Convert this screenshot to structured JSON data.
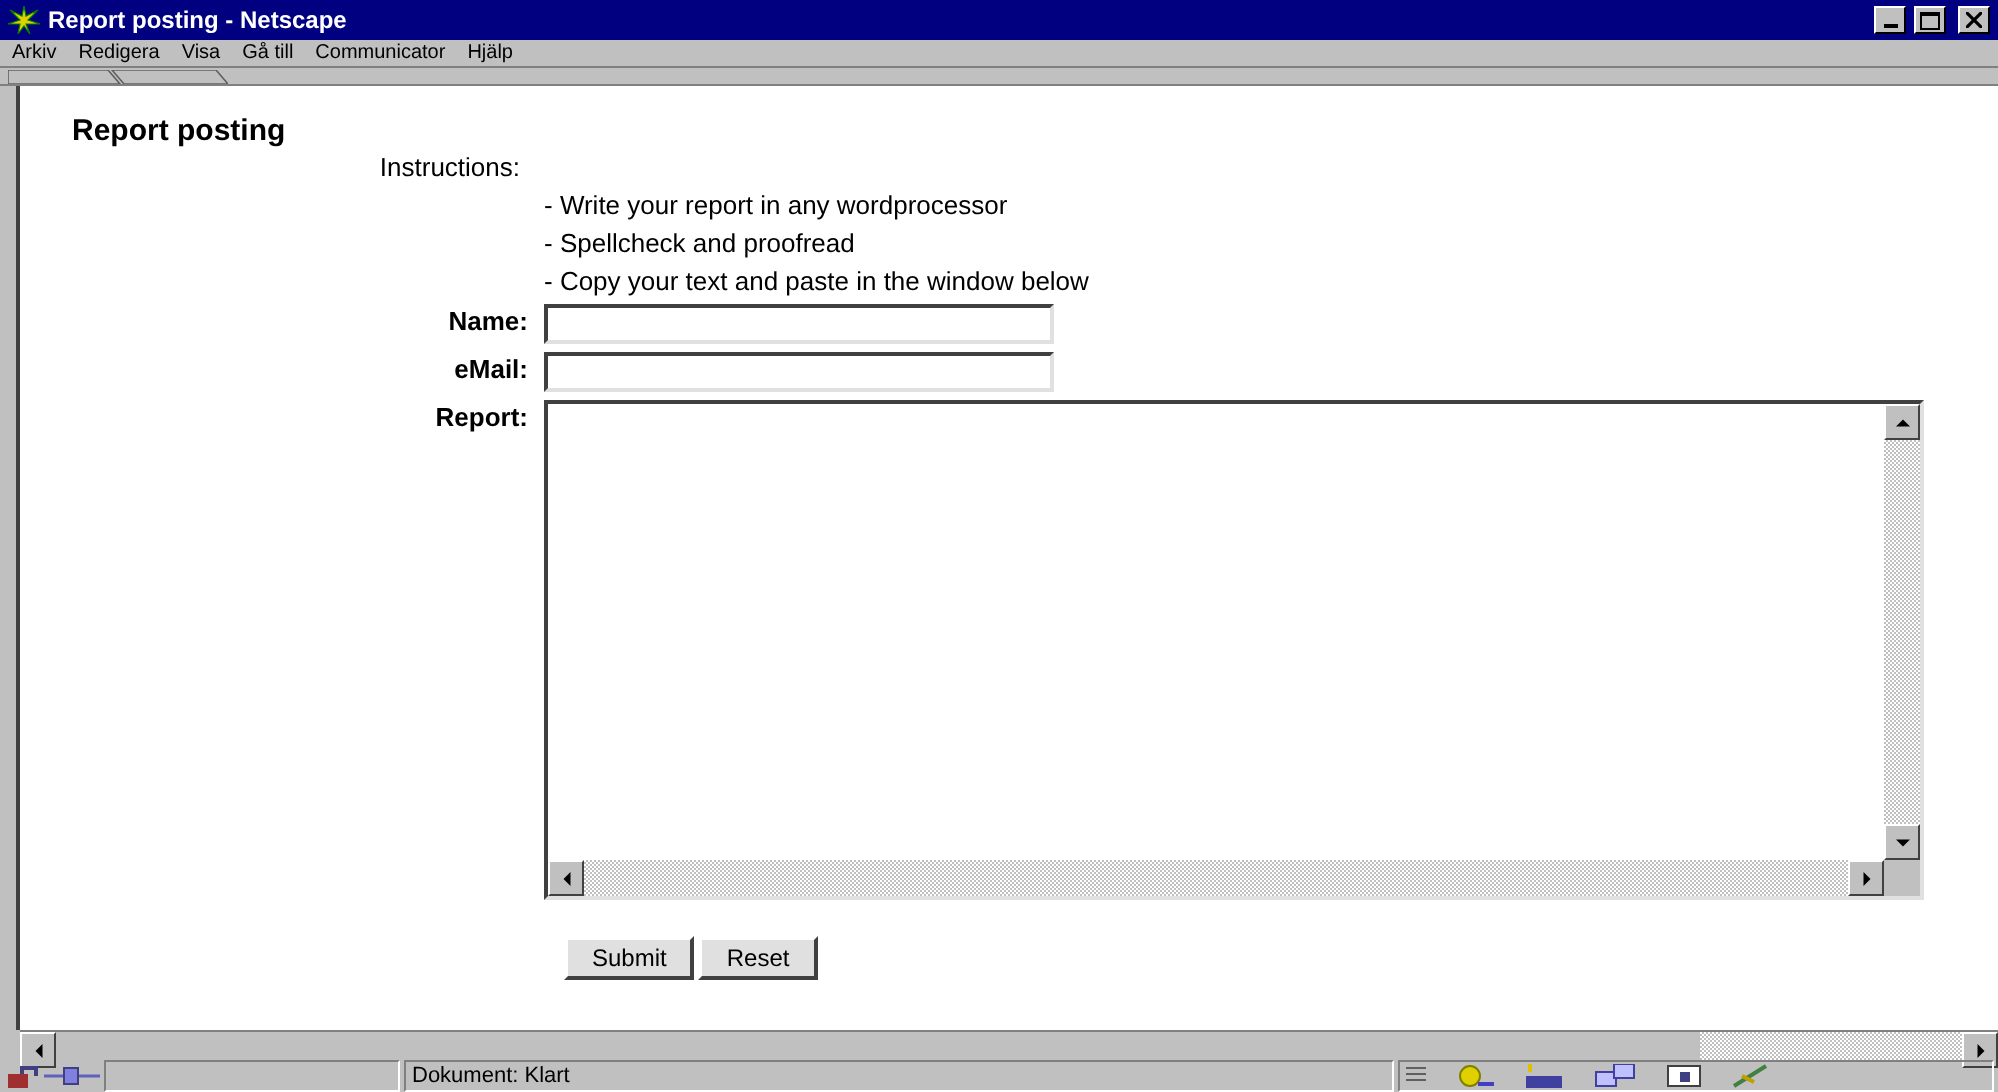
{
  "window": {
    "title": "Report posting - Netscape"
  },
  "menu": [
    "Arkiv",
    "Redigera",
    "Visa",
    "Gå till",
    "Communicator",
    "Hjälp"
  ],
  "page": {
    "heading": "Report posting",
    "instructions_label": "Instructions:",
    "instructions": [
      "- Write your report in any wordprocessor",
      "- Spellcheck and proofread",
      "- Copy your text and paste in the window below"
    ],
    "fields": [
      {
        "label": "Name:",
        "kind": "input"
      },
      {
        "label": "eMail:",
        "kind": "input"
      },
      {
        "label": "Report:",
        "kind": "textarea"
      }
    ],
    "buttons": [
      "Submit",
      "Reset"
    ]
  },
  "status_bar": {
    "text": "Dokument: Klart"
  }
}
